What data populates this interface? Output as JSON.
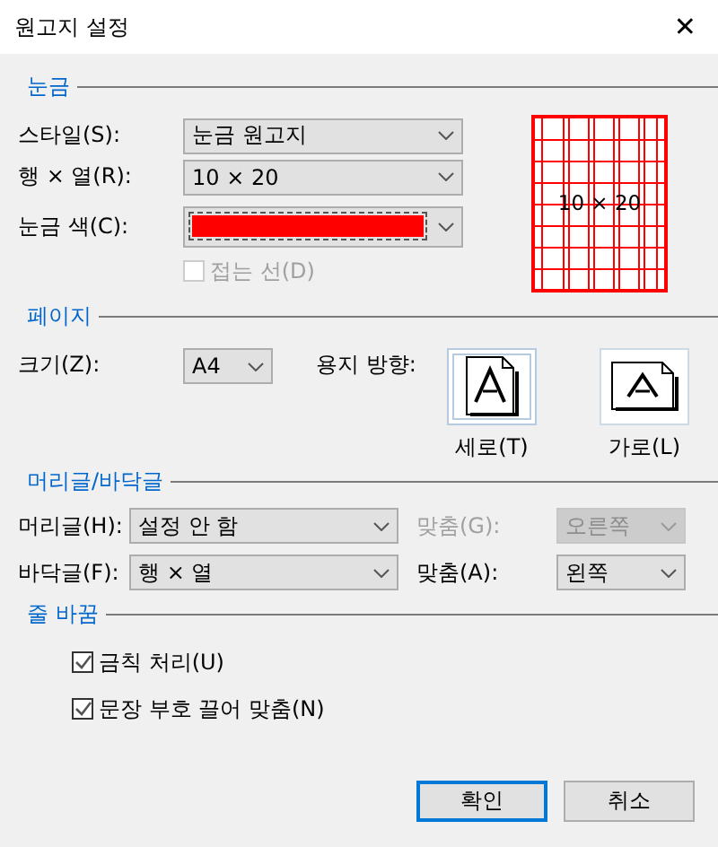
{
  "window": {
    "title": "원고지 설정",
    "close": "✕"
  },
  "grid": {
    "title": "눈금",
    "fields": [
      {
        "kind": "select",
        "label": "스타일(S):",
        "value": "눈금 원고지"
      },
      {
        "kind": "select",
        "label": "행 × 열(R):",
        "value": "10 × 20"
      },
      {
        "kind": "color",
        "label": "눈금 색(C):",
        "color": "#ff0000"
      }
    ],
    "fold_line": {
      "label": "접는 선(D)",
      "checked": false,
      "disabled": true
    },
    "preview": {
      "text": "10 × 20"
    }
  },
  "page": {
    "title": "페이지",
    "size": {
      "label": "크기(Z):",
      "value": "A4"
    },
    "orientation": {
      "label": "용지 방향:",
      "options": [
        {
          "label": "세로(T)",
          "selected": true,
          "kind": "portrait"
        },
        {
          "label": "가로(L)",
          "selected": false,
          "kind": "landscape"
        }
      ]
    }
  },
  "header_footer": {
    "title": "머리글/바닥글",
    "rows": [
      {
        "label": "머리글(H):",
        "value": "설정 안 함",
        "align_label": "맞춤(G):",
        "align_value": "오른쪽",
        "align_disabled": true
      },
      {
        "label": "바닥글(F):",
        "value": "행 × 열",
        "align_label": "맞춤(A):",
        "align_value": "왼쪽",
        "align_disabled": false
      }
    ]
  },
  "line_break": {
    "title": "줄 바꿈",
    "options": [
      {
        "label": "금칙 처리(U)",
        "checked": true
      },
      {
        "label": "문장 부호 끌어 맞춤(N)",
        "checked": true
      }
    ]
  },
  "buttons": [
    {
      "label": "확인",
      "primary": true
    },
    {
      "label": "취소",
      "primary": false
    }
  ]
}
